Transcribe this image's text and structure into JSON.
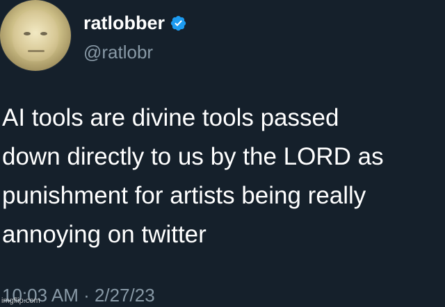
{
  "tweet": {
    "author": {
      "display_name": "ratlobber",
      "handle": "@ratlobr",
      "verified": true,
      "avatar_icon": "baby-face-avatar-icon",
      "verified_icon": "verified-badge-icon",
      "verified_color": "#1d9bf0"
    },
    "text_lines": [
      "AI tools are divine tools passed",
      "down directly to us by the LORD as",
      "punishment for artists being really",
      "annoying on twitter"
    ],
    "timestamp": "10:03 AM · 2/27/23"
  },
  "watermark": {
    "text": "imgflip.com"
  },
  "colors": {
    "background": "#15202b",
    "primary_text": "#ffffff",
    "secondary_text": "#8899a6"
  }
}
